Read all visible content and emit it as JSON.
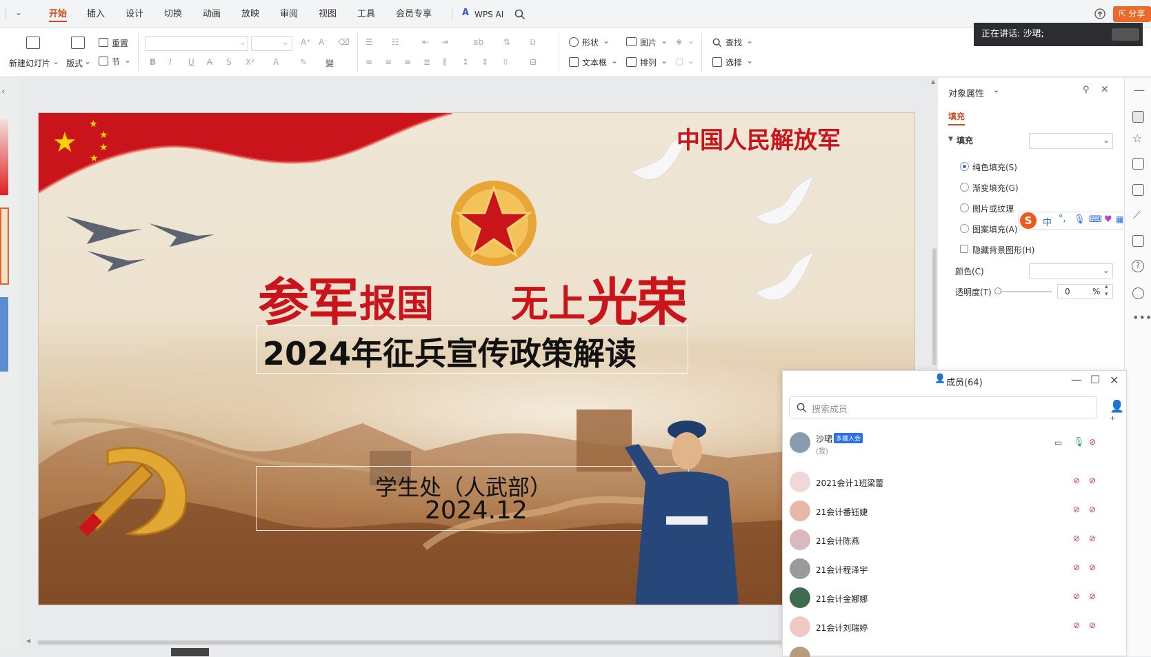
{
  "menubar": {
    "tabs": [
      "开始",
      "插入",
      "设计",
      "切换",
      "动画",
      "放映",
      "审阅",
      "视图",
      "工具",
      "会员专享"
    ],
    "active_tab": "开始",
    "wps_ai": "WPS AI",
    "share": "分享"
  },
  "ribbon": {
    "new_slide": "新建幻灯片",
    "layout": "版式",
    "reset": "重置",
    "section": "节",
    "shape": "形状",
    "picture": "图片",
    "textbox": "文本框",
    "arrange": "排列",
    "find": "查找",
    "select": "选择"
  },
  "speaking": "正在讲话:  沙珺;",
  "slide": {
    "top_right": "中国人民解放军",
    "slogan_left_big": "参军",
    "slogan_left_small": "报国",
    "slogan_right_small": "无上",
    "slogan_right_big": "光荣",
    "title": "2024年征兵宣传政策解读",
    "department": "学生处（人武部）",
    "date": "2024.12"
  },
  "props": {
    "title": "对象属性",
    "tab": "填充",
    "fill_section": "填充",
    "options": [
      "纯色填充(S)",
      "渐变填充(G)",
      "图片或纹理",
      "图案填充(A)"
    ],
    "hide_bg": "隐藏背景图形(H)",
    "color_label": "颜色(C)",
    "transparency_label": "透明度(T)",
    "transparency_value": "0",
    "transparency_unit": "%"
  },
  "members": {
    "title": "成员(64)",
    "search_placeholder": "搜索成员",
    "list": [
      {
        "name": "沙珺",
        "sub": "(我)",
        "badge": "多端入会",
        "color": "#8a9bb0"
      },
      {
        "name": "2021会计1班梁蕾",
        "color": "#f2d7d9"
      },
      {
        "name": "21会计番钰婕",
        "color": "#e7b9a5"
      },
      {
        "name": "21会计陈燕",
        "color": "#d9b8c0"
      },
      {
        "name": "21会计程泽宇",
        "color": "#9a9a9a"
      },
      {
        "name": "21会计金娜娜",
        "color": "#3f6b4f"
      },
      {
        "name": "21会计刘瑞婷",
        "color": "#f0c9c4"
      }
    ]
  },
  "colors": {
    "accent": "#c94b1a",
    "slide_red": "#c8141a",
    "link_blue": "#2a6ee8"
  }
}
